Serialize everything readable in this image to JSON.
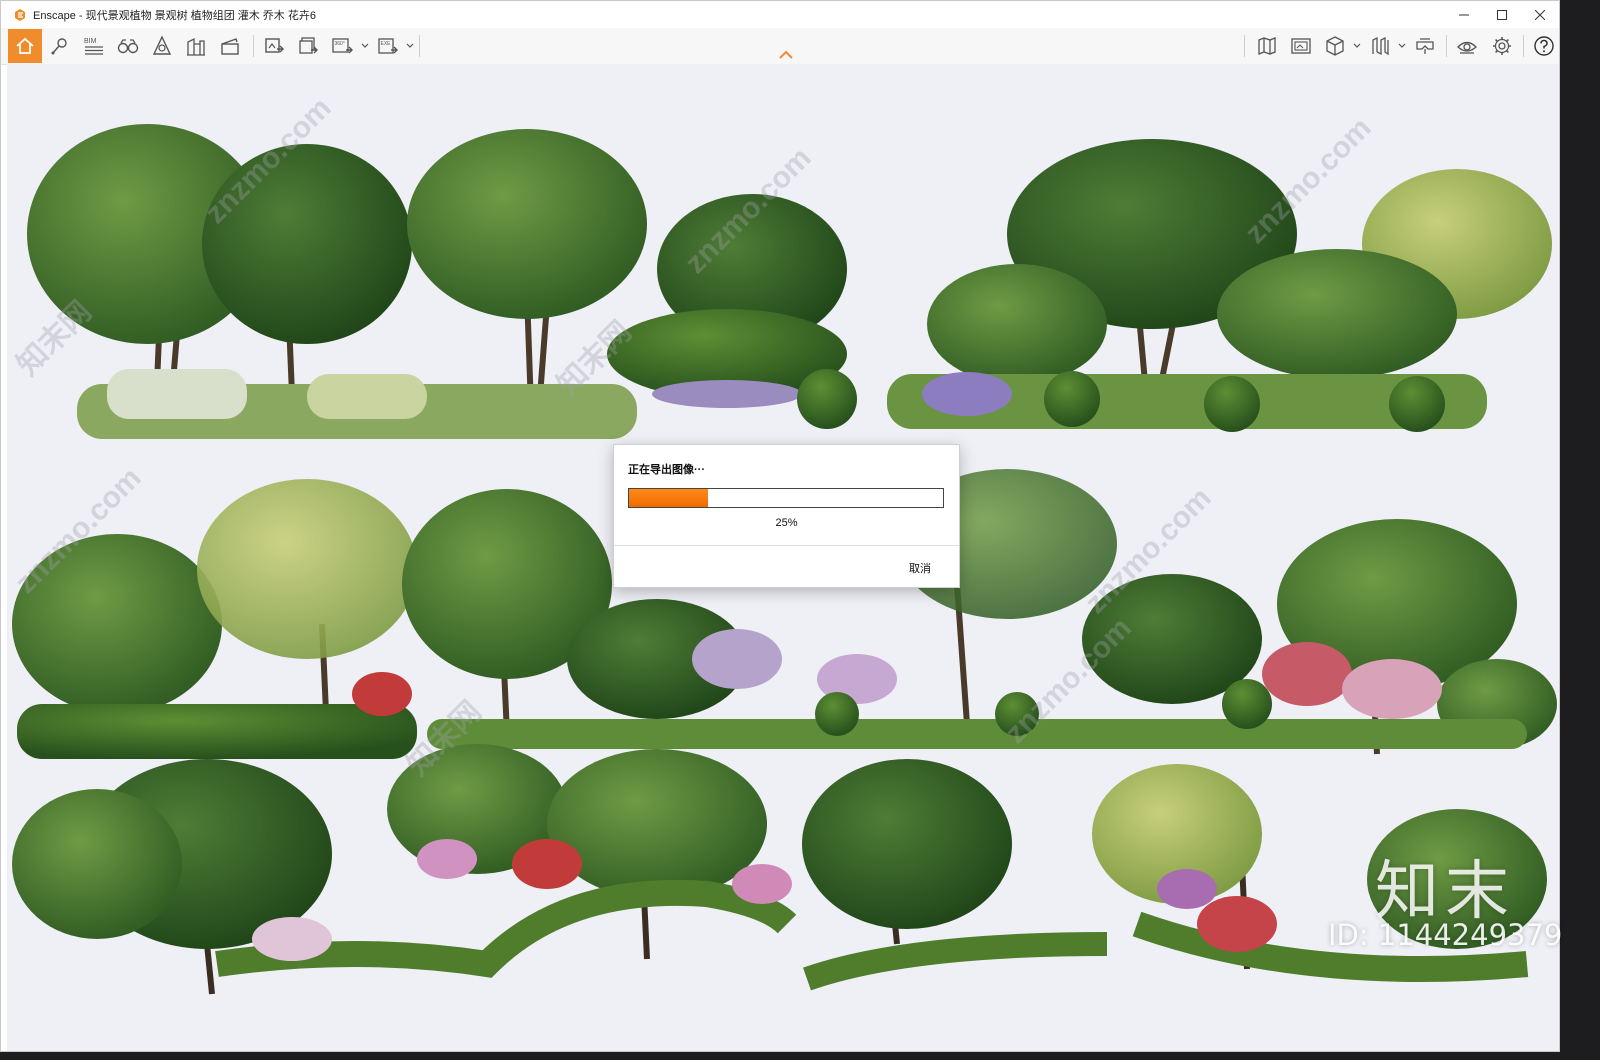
{
  "window": {
    "title": "Enscape - 现代景观植物 景观树 植物组团 灌木 乔木 花卉6",
    "brand_color": "#f08c2c"
  },
  "toolbar": {
    "left_tools": [
      "home-icon",
      "pin-icon",
      "bim-icon",
      "binoculars-icon",
      "assets-icon",
      "buildings-icon",
      "clapper-icon",
      "screenshot-icon",
      "batch-render-icon",
      "panorama-360-icon",
      "export-exe-icon"
    ],
    "bim_label": "BIM",
    "pano_label": "360°",
    "exe_label": "EXE",
    "right_tools": [
      "map-icon",
      "view-manager-icon",
      "cube-icon",
      "sections-icon",
      "vr-icon",
      "eye-icon",
      "settings-icon",
      "help-icon"
    ]
  },
  "dialog": {
    "title": "正在导出图像···",
    "progress": 25,
    "progress_text": "25%",
    "cancel_label": "取消"
  },
  "watermark": {
    "site": "znzmo.com",
    "brand": "知末网",
    "logo": "知末",
    "id_text": "ID: 1144249379"
  }
}
